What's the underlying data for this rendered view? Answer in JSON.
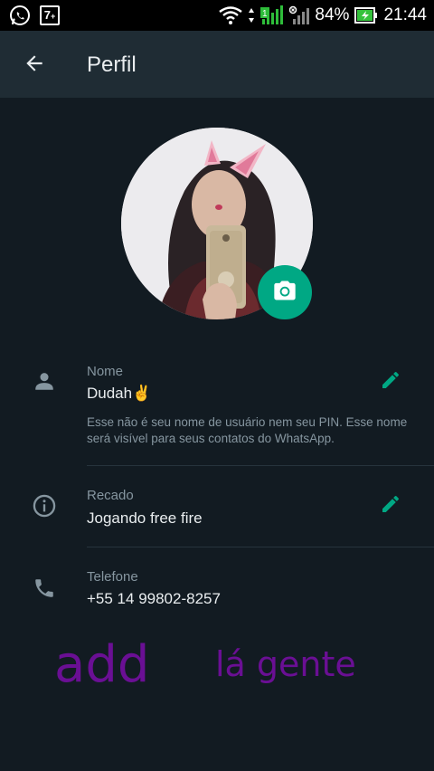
{
  "status_bar": {
    "battery": "84%",
    "time": "21:44",
    "badge": "7",
    "badge_plus": "+",
    "signal_label": "1"
  },
  "header": {
    "title": "Perfil"
  },
  "profile": {
    "name_label": "Nome",
    "name_value": "Dudah✌️",
    "name_note": "Esse não é seu nome de usuário nem seu PIN. Esse nome será visível para seus contatos do WhatsApp.",
    "about_label": "Recado",
    "about_value": "Jogando free fire",
    "phone_label": "Telefone",
    "phone_value": "+55 14 99802-8257"
  },
  "overlay": {
    "left": "add",
    "right": "lá gente"
  },
  "colors": {
    "accent": "#00a884",
    "background": "#121b22",
    "app_bar": "#1f2c34",
    "overlay_text": "#6a0f94"
  },
  "icons": [
    "whatsapp-icon",
    "notification-badge-icon",
    "wifi-icon",
    "signal-icon",
    "battery-icon",
    "back-arrow-icon",
    "camera-icon",
    "person-icon",
    "info-icon",
    "phone-icon",
    "pencil-icon"
  ]
}
